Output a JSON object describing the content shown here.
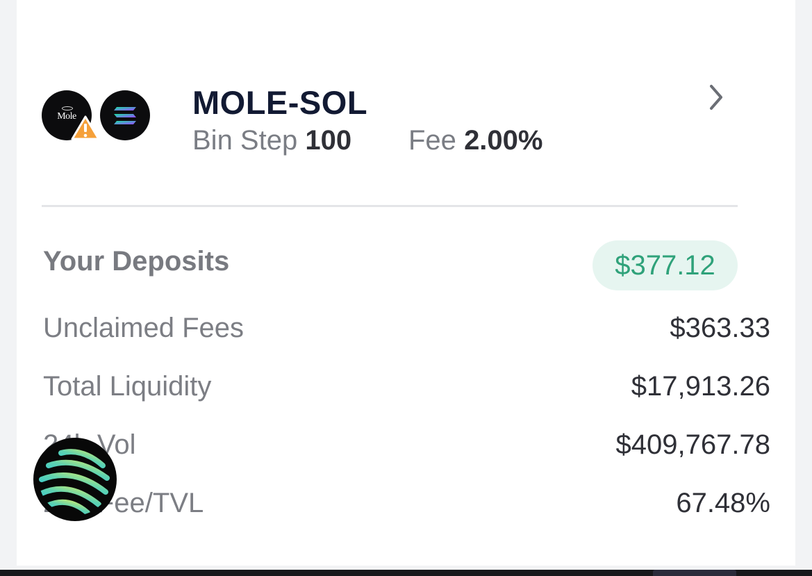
{
  "pool": {
    "name": "MOLE-SOL",
    "bin_step_label": "Bin Step",
    "bin_step_value": "100",
    "fee_label": "Fee",
    "fee_value": "2.00%",
    "token_a": {
      "symbol_text": "Mole",
      "icon": "mole-token-icon",
      "warning_icon": "warning-icon"
    },
    "token_b": {
      "icon": "solana-token-icon"
    }
  },
  "stats": {
    "deposits_label": "Your Deposits",
    "deposits_value": "$377.12",
    "unclaimed_label": "Unclaimed Fees",
    "unclaimed_value": "$363.33",
    "liquidity_label": "Total Liquidity",
    "liquidity_value": "$17,913.26",
    "volume_label": "24h Vol",
    "volume_value": "$409,767.78",
    "ratio_label": "24h Fee/TVL",
    "ratio_value": "67.48%"
  },
  "colors": {
    "accent_green": "#2fa27a",
    "pill_bg": "#e6f5f0",
    "title": "#121a33",
    "warning": "#f5a03a"
  },
  "floating_button": {
    "icon": "striped-orb-icon"
  }
}
